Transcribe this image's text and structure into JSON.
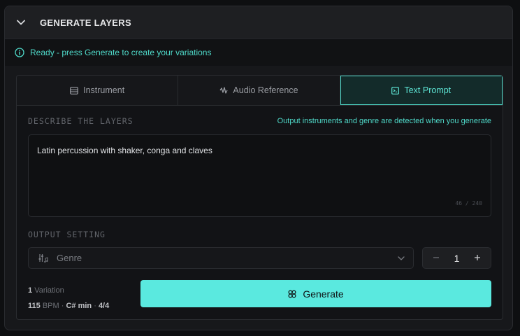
{
  "header": {
    "title": "GENERATE LAYERS",
    "collapse_icon": "chevron-down-icon"
  },
  "status": {
    "text": "Ready - press Generate to create your variations",
    "icon": "info-icon",
    "color": "#4fd9c9"
  },
  "tabs": [
    {
      "label": "Instrument",
      "icon": "instrument-icon",
      "active": false
    },
    {
      "label": "Audio Reference",
      "icon": "waveform-icon",
      "active": false
    },
    {
      "label": "Text Prompt",
      "icon": "text-prompt-icon",
      "active": true
    }
  ],
  "describe": {
    "label": "DESCRIBE THE LAYERS",
    "hint": "Output instruments and genre are detected when you generate",
    "value": "Latin percussion with shaker, conga and claves",
    "counter": "46 / 240"
  },
  "output": {
    "label": "OUTPUT SETTING",
    "genre_placeholder": "Genre",
    "variations_count": "1"
  },
  "meta": {
    "variation_count": "1",
    "variation_word": "Variation",
    "bpm": "115",
    "bpm_unit": "BPM",
    "sep": "·",
    "key": "C# min",
    "time_signature": "4/4"
  },
  "generate": {
    "label": "Generate"
  },
  "colors": {
    "accent": "#5ae9df",
    "panel": "#17181b",
    "border": "#2a2c30"
  }
}
